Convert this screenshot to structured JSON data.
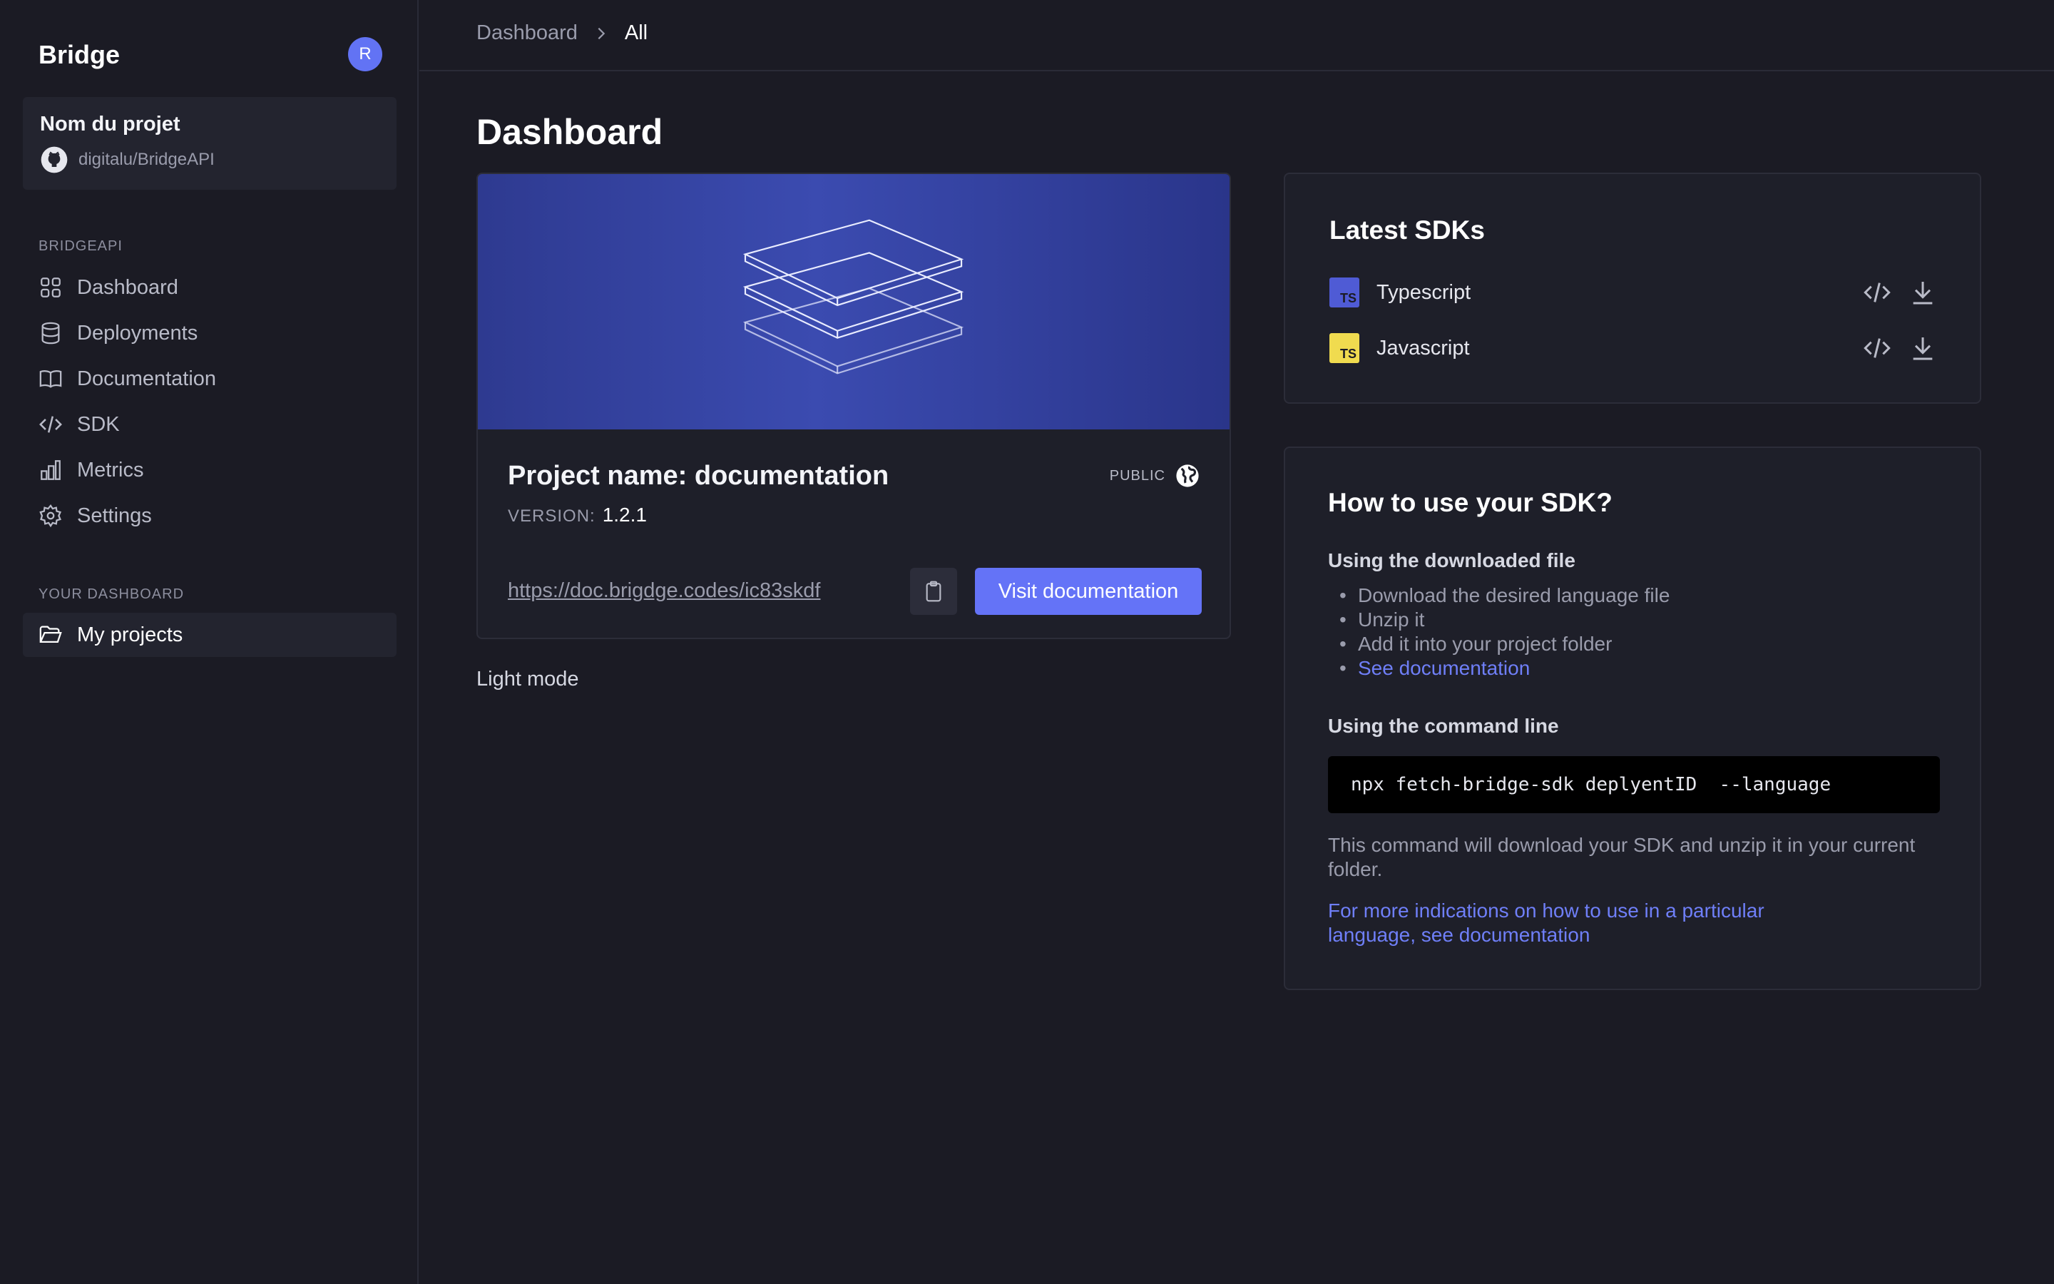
{
  "sidebar": {
    "brand": "Bridge",
    "avatar_initial": "R",
    "project": {
      "name": "Nom du projet",
      "repo": "digitalu/BridgeAPI"
    },
    "section_1_title": "BRIDGEAPI",
    "items": [
      {
        "label": "Dashboard",
        "icon": "grid-icon"
      },
      {
        "label": "Deployments",
        "icon": "database-icon"
      },
      {
        "label": "Documentation",
        "icon": "book-icon"
      },
      {
        "label": "SDK",
        "icon": "code-icon"
      },
      {
        "label": "Metrics",
        "icon": "bar-chart-icon"
      },
      {
        "label": "Settings",
        "icon": "gear-icon"
      }
    ],
    "section_2_title": "YOUR DASHBOARD",
    "projects_item": {
      "label": "My projects",
      "icon": "folder-open-icon"
    }
  },
  "breadcrumb": {
    "first": "Dashboard",
    "current": "All"
  },
  "page_title": "Dashboard",
  "project_card": {
    "title": "Project name: documentation",
    "visibility": "PUBLIC",
    "version_label": "VERSION:",
    "version": "1.2.1",
    "url": "https://doc.brigdge.codes/ic83skdf",
    "visit_label": "Visit documentation"
  },
  "light_mode_label": "Light mode",
  "sdks": {
    "title": "Latest SDKs",
    "items": [
      {
        "name": "Typescript",
        "badge": "TS",
        "badge_color": "#4f5bd5"
      },
      {
        "name": "Javascript",
        "badge": "TS",
        "badge_color": "#f0db4f"
      }
    ]
  },
  "how_to": {
    "title": "How to use your SDK?",
    "downloaded_heading": "Using the downloaded file",
    "steps": [
      "Download the desired language file",
      "Unzip it",
      "Add it into your project folder"
    ],
    "see_doc": "See documentation",
    "cli_heading": "Using the command line",
    "command": "npx fetch-bridge-sdk deplyentID  --language",
    "description": "This command will download your SDK and unzip it in your current folder.",
    "more_link": "For more indications on how to use in a particular language, see documentation"
  },
  "colors": {
    "background": "#1b1b24",
    "accent": "#6473f7",
    "card_border": "#2c2d39"
  }
}
